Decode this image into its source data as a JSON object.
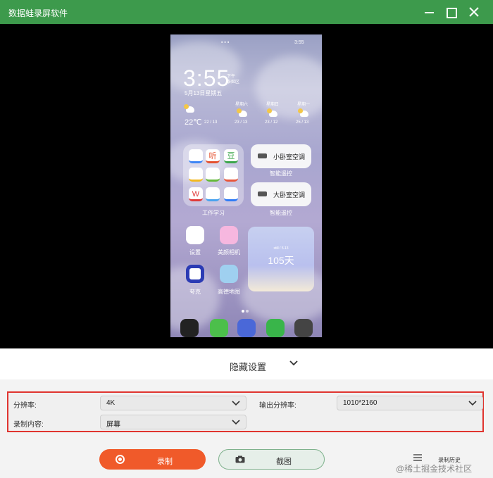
{
  "window": {
    "title": "数据蛙录屏软件",
    "controls": {
      "minimize": "minimize",
      "maximize": "maximize",
      "close": "close"
    }
  },
  "phone": {
    "status_time": "3:55",
    "clock_time": "3:55",
    "clock_sub": [
      "下午",
      "泰姬区"
    ],
    "date": "5月13日星期五",
    "weather": {
      "temp": "22℃",
      "range": "22 / 13"
    },
    "forecast": [
      {
        "day": "星期六",
        "range": "23 / 13"
      },
      {
        "day": "星期日",
        "range": "23 / 12"
      },
      {
        "day": "星期一",
        "range": "25 / 13"
      }
    ],
    "folder": {
      "label": "工作学习",
      "icons": [
        {
          "name": "notes-app-icon",
          "glyph": "",
          "color": "#3f86f5"
        },
        {
          "name": "ting-app-icon",
          "glyph": "听",
          "color": "#e5512f"
        },
        {
          "name": "douban-app-icon",
          "glyph": "豆",
          "color": "#3ba64b"
        },
        {
          "name": "baidu-netdisk-app-icon",
          "glyph": "",
          "color": "#f2b820"
        },
        {
          "name": "duolingo-app-icon",
          "glyph": "",
          "color": "#64b93a"
        },
        {
          "name": "search-app-icon",
          "glyph": "",
          "color": "#e8563a"
        },
        {
          "name": "wps-app-icon",
          "glyph": "W",
          "color": "#e03a3a"
        },
        {
          "name": "qq-app-icon",
          "glyph": "",
          "color": "#49a3ef"
        },
        {
          "name": "tencent-docs-app-icon",
          "glyph": "",
          "color": "#2f7cf6"
        }
      ]
    },
    "remote_cards": [
      {
        "text": "小卧室空调",
        "label": "智能遥控"
      },
      {
        "text": "大卧室空调",
        "label": "智能遥控"
      }
    ],
    "apps": [
      {
        "label": "设置"
      },
      {
        "label": "美颜相机"
      },
      {
        "label": "夸克"
      },
      {
        "label": "高德地图"
      }
    ],
    "widget": {
      "caption": "still / 5.13",
      "days": "105天"
    },
    "dock": [
      {
        "name": "camera-dock-icon",
        "color": "#222"
      },
      {
        "name": "messages-dock-icon",
        "color": "#4cbf4b"
      },
      {
        "name": "alipay-dock-icon",
        "color": "#4a68d8"
      },
      {
        "name": "wechat-dock-icon",
        "color": "#39b54a"
      },
      {
        "name": "lock-dock-icon",
        "color": "#444"
      }
    ]
  },
  "hidden_settings": {
    "label": "隐藏设置"
  },
  "settings": {
    "resolution": {
      "label": "分辨率:",
      "value": "4K"
    },
    "output_resolution": {
      "label": "输出分辨率:",
      "value": "1010*2160"
    },
    "record_content": {
      "label": "录制内容:",
      "value": "屏幕"
    }
  },
  "actions": {
    "record": "录制",
    "screenshot": "截图",
    "history": "录制历史"
  },
  "watermark": "@稀土掘金技术社区",
  "colors": {
    "titlebar": "#3d9a4c",
    "record_button": "#f05a2a",
    "highlight_border": "#e0342f"
  }
}
